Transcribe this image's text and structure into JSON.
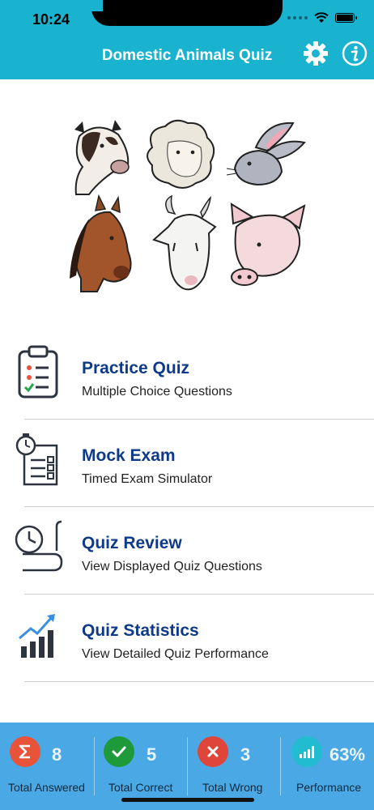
{
  "status_bar": {
    "time": "10:24"
  },
  "header": {
    "title": "Domestic Animals Quiz",
    "settings_icon": "gear-icon",
    "info_icon": "info-icon"
  },
  "colors": {
    "header": "#1ab3cf",
    "footer": "#4aa8e4",
    "menu_title": "#0f3a8a",
    "answered": "#e8533a",
    "correct": "#1f9a3a",
    "wrong": "#e0453a",
    "performance": "#22bcd0"
  },
  "animals": [
    "cow",
    "sheep",
    "rabbit",
    "horse",
    "goat",
    "pig"
  ],
  "menu": [
    {
      "title": "Practice Quiz",
      "subtitle": "Multiple Choice Questions",
      "icon": "clipboard-checklist-icon"
    },
    {
      "title": "Mock Exam",
      "subtitle": "Timed Exam Simulator",
      "icon": "stopwatch-checklist-icon"
    },
    {
      "title": "Quiz Review",
      "subtitle": "View Displayed Quiz Questions",
      "icon": "clock-scroll-icon"
    },
    {
      "title": "Quiz Statistics",
      "subtitle": "View Detailed Quiz Performance",
      "icon": "bar-chart-trend-icon"
    }
  ],
  "stats": [
    {
      "label": "Total Answered",
      "value": "8",
      "icon": "sigma-icon"
    },
    {
      "label": "Total Correct",
      "value": "5",
      "icon": "checkmark-icon"
    },
    {
      "label": "Total Wrong",
      "value": "3",
      "icon": "cross-icon"
    },
    {
      "label": "Performance",
      "value": "63%",
      "icon": "bar-chart-icon"
    }
  ]
}
